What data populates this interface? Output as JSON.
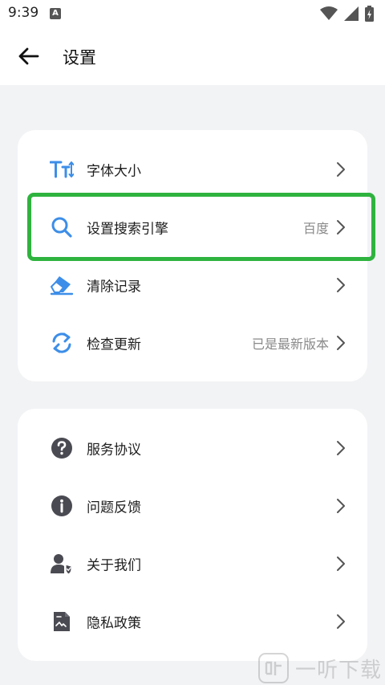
{
  "status": {
    "time": "9:39",
    "notif_badge": "A"
  },
  "header": {
    "title": "设置"
  },
  "card1": {
    "items": [
      {
        "label": "字体大小",
        "value": "",
        "icon": "font-size-icon"
      },
      {
        "label": "设置搜索引擎",
        "value": "百度",
        "icon": "search-icon"
      },
      {
        "label": "清除记录",
        "value": "",
        "icon": "eraser-icon"
      },
      {
        "label": "检查更新",
        "value": "已是最新版本",
        "icon": "refresh-icon"
      }
    ]
  },
  "card2": {
    "items": [
      {
        "label": "服务协议",
        "icon": "question-icon"
      },
      {
        "label": "问题反馈",
        "icon": "info-icon"
      },
      {
        "label": "关于我们",
        "icon": "user-shield-icon"
      },
      {
        "label": "隐私政策",
        "icon": "document-icon"
      }
    ]
  },
  "watermark": {
    "text": "一听下载"
  },
  "colors": {
    "accent_blue": "#3d8ee8",
    "highlight_green": "#2fb33f",
    "gray_icon": "#4a4a52"
  }
}
